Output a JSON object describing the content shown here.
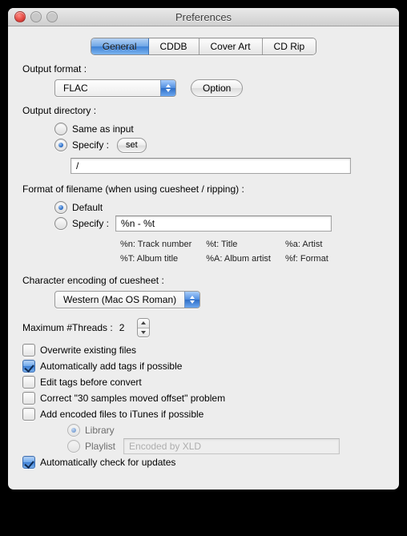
{
  "window": {
    "title": "Preferences"
  },
  "tabs": [
    "General",
    "CDDB",
    "Cover Art",
    "CD Rip"
  ],
  "active_tab": 0,
  "output_format": {
    "label": "Output format :",
    "value": "FLAC",
    "option_btn": "Option"
  },
  "output_dir": {
    "label": "Output directory :",
    "same": "Same as input",
    "specify": "Specify :",
    "set_btn": "set",
    "selected": "specify",
    "path": "/"
  },
  "fname": {
    "label": "Format of filename (when using cuesheet / ripping) :",
    "default": "Default",
    "specify": "Specify :",
    "selected": "default",
    "pattern": "%n - %t",
    "hints": {
      "n": "%n: Track number",
      "t": "%t: Title",
      "a": "%a: Artist",
      "T": "%T: Album title",
      "A": "%A: Album artist",
      "f": "%f: Format"
    }
  },
  "encoding": {
    "label": "Character encoding of cuesheet :",
    "value": "Western (Mac OS Roman)"
  },
  "threads": {
    "label": "Maximum #Threads :",
    "value": "2"
  },
  "checks": {
    "overwrite": {
      "label": "Overwrite existing files",
      "checked": false
    },
    "autotag": {
      "label": "Automatically add tags if possible",
      "checked": true
    },
    "edit": {
      "label": "Edit tags before convert",
      "checked": false
    },
    "offset": {
      "label": "Correct \"30 samples moved offset\" problem",
      "checked": false
    },
    "itunes": {
      "label": "Add encoded files to iTunes if possible",
      "checked": false
    },
    "updates": {
      "label": "Automatically check for updates",
      "checked": true
    }
  },
  "itunes_sub": {
    "library": "Library",
    "playlist": "Playlist",
    "playlist_placeholder": "Encoded by XLD",
    "selected": "library"
  }
}
